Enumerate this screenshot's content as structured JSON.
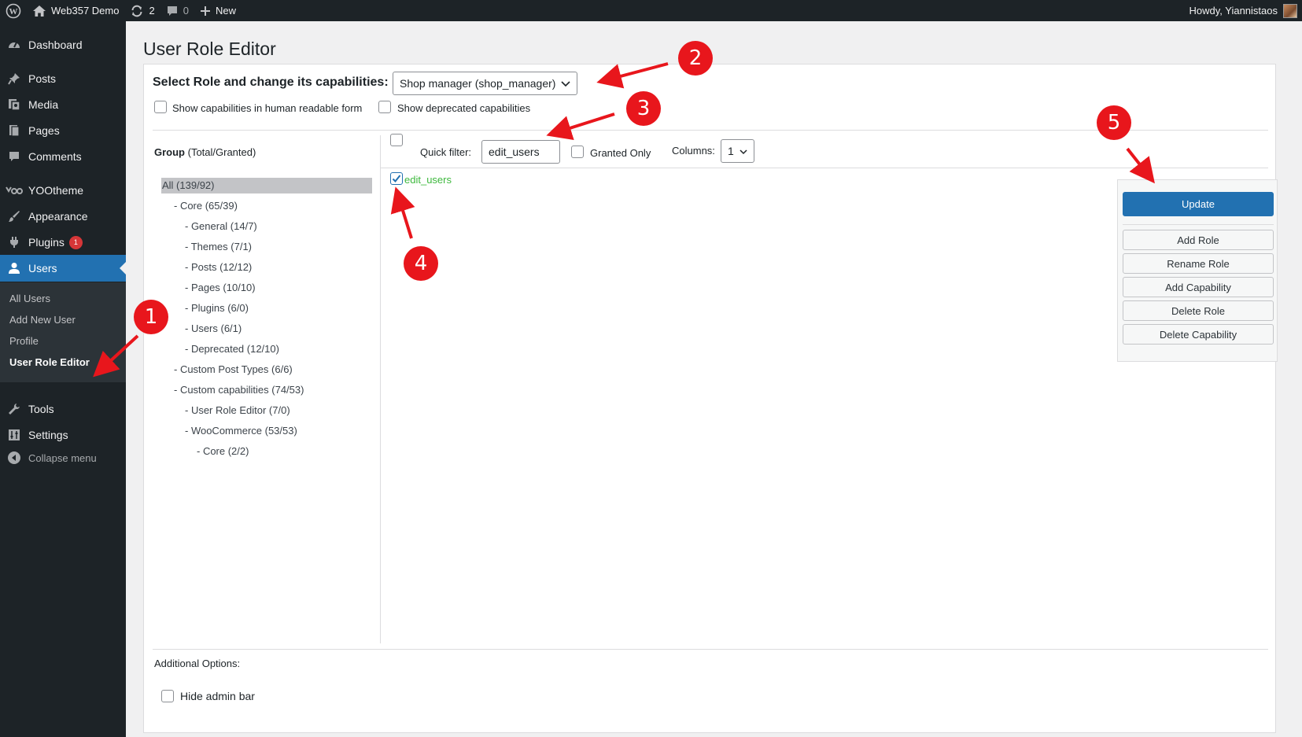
{
  "admin_bar": {
    "site_name": "Web357 Demo",
    "updates_count": "2",
    "comments_count": "0",
    "new_label": "New",
    "howdy": "Howdy, Yiannistaos"
  },
  "sidebar": {
    "items": [
      {
        "label": "Dashboard",
        "icon": "dashboard-icon"
      },
      {
        "label": "Posts",
        "icon": "pin-icon"
      },
      {
        "label": "Media",
        "icon": "media-icon"
      },
      {
        "label": "Pages",
        "icon": "page-icon"
      },
      {
        "label": "Comments",
        "icon": "comment-icon"
      },
      {
        "label": "YOOtheme",
        "icon": "yootheme-icon"
      },
      {
        "label": "Appearance",
        "icon": "brush-icon"
      },
      {
        "label": "Plugins",
        "icon": "plugin-icon",
        "badge": "1"
      },
      {
        "label": "Users",
        "icon": "user-icon"
      },
      {
        "label": "Tools",
        "icon": "wrench-icon"
      },
      {
        "label": "Settings",
        "icon": "settings-icon"
      }
    ],
    "submenu": [
      "All Users",
      "Add New User",
      "Profile",
      "User Role Editor"
    ],
    "collapse_label": "Collapse menu"
  },
  "page": {
    "title": "User Role Editor",
    "role_label": "Select Role and change its capabilities:",
    "role_value": "Shop manager (shop_manager)",
    "show_human_readable": "Show capabilities in human readable form",
    "show_deprecated": "Show deprecated capabilities",
    "group_head_bold": "Group",
    "group_head_rest": " (Total/Granted)",
    "quick_filter_label": "Quick filter:",
    "quick_filter_value": "edit_users",
    "granted_only": "Granted Only",
    "columns_label": "Columns:",
    "columns_value": "1",
    "capability": "edit_users",
    "additional_options": "Additional Options:",
    "hide_admin_bar": "Hide admin bar"
  },
  "tree": [
    "All (139/92)",
    "- Core (65/39)",
    "- General (14/7)",
    "- Themes (7/1)",
    "- Posts (12/12)",
    "- Pages (10/10)",
    "- Plugins (6/0)",
    "- Users (6/1)",
    "- Deprecated (12/10)",
    "- Custom Post Types (6/6)",
    "- Custom capabilities (74/53)",
    "- User Role Editor (7/0)",
    "- WooCommerce (53/53)",
    "- Core (2/2)"
  ],
  "buttons": {
    "update": "Update",
    "add_role": "Add Role",
    "rename_role": "Rename Role",
    "add_capability": "Add Capability",
    "delete_role": "Delete Role",
    "delete_capability": "Delete Capability"
  },
  "annotations": [
    "1",
    "2",
    "3",
    "4",
    "5"
  ],
  "colors": {
    "accent": "#2271b1",
    "annotation": "#e8161c",
    "granted": "#3db83d",
    "sidebar": "#1d2327"
  }
}
